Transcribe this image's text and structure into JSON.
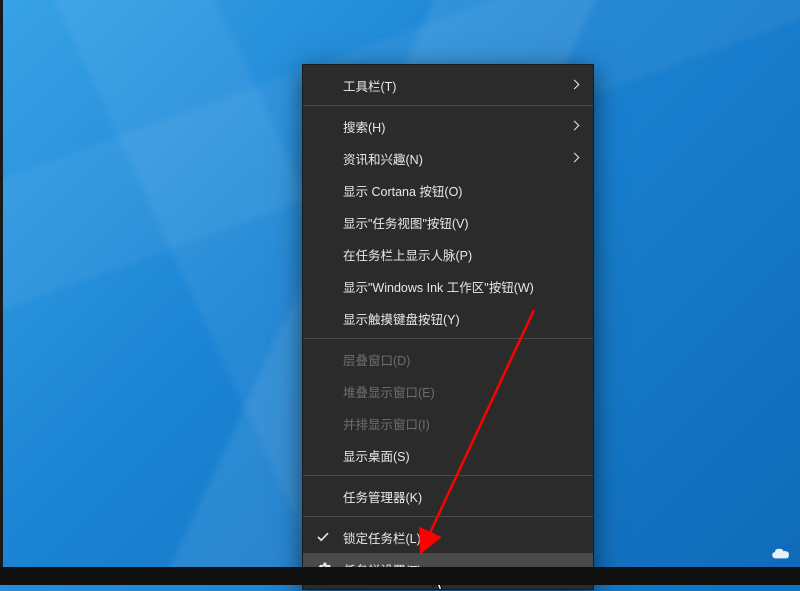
{
  "menu": {
    "items": [
      {
        "label": "工具栏(T)",
        "submenu": true,
        "disabled": false,
        "icon": null
      },
      {
        "sep": true
      },
      {
        "label": "搜索(H)",
        "submenu": true,
        "disabled": false,
        "icon": null
      },
      {
        "label": "资讯和兴趣(N)",
        "submenu": true,
        "disabled": false,
        "icon": null
      },
      {
        "label": "显示 Cortana 按钮(O)",
        "submenu": false,
        "disabled": false,
        "icon": null
      },
      {
        "label": "显示\"任务视图\"按钮(V)",
        "submenu": false,
        "disabled": false,
        "icon": null
      },
      {
        "label": "在任务栏上显示人脉(P)",
        "submenu": false,
        "disabled": false,
        "icon": null
      },
      {
        "label": "显示\"Windows Ink 工作区\"按钮(W)",
        "submenu": false,
        "disabled": false,
        "icon": null
      },
      {
        "label": "显示触摸键盘按钮(Y)",
        "submenu": false,
        "disabled": false,
        "icon": null
      },
      {
        "sep": true
      },
      {
        "label": "层叠窗口(D)",
        "submenu": false,
        "disabled": true,
        "icon": null
      },
      {
        "label": "堆叠显示窗口(E)",
        "submenu": false,
        "disabled": true,
        "icon": null
      },
      {
        "label": "并排显示窗口(I)",
        "submenu": false,
        "disabled": true,
        "icon": null
      },
      {
        "label": "显示桌面(S)",
        "submenu": false,
        "disabled": false,
        "icon": null
      },
      {
        "sep": true
      },
      {
        "label": "任务管理器(K)",
        "submenu": false,
        "disabled": false,
        "icon": null
      },
      {
        "sep": true
      },
      {
        "label": "锁定任务栏(L)",
        "submenu": false,
        "disabled": false,
        "icon": "check"
      },
      {
        "label": "任务栏设置(T)",
        "submenu": false,
        "disabled": false,
        "icon": "gear",
        "highlighted": true
      }
    ]
  },
  "colors": {
    "menuBg": "#2b2b2b",
    "menuText": "#e8e8e8",
    "menuDisabled": "#6e6e6e",
    "highlight": "#4a4a4a",
    "arrow": "#ff0000",
    "desktop1": "#2a8dd8",
    "desktop2": "#0f6bb8"
  }
}
